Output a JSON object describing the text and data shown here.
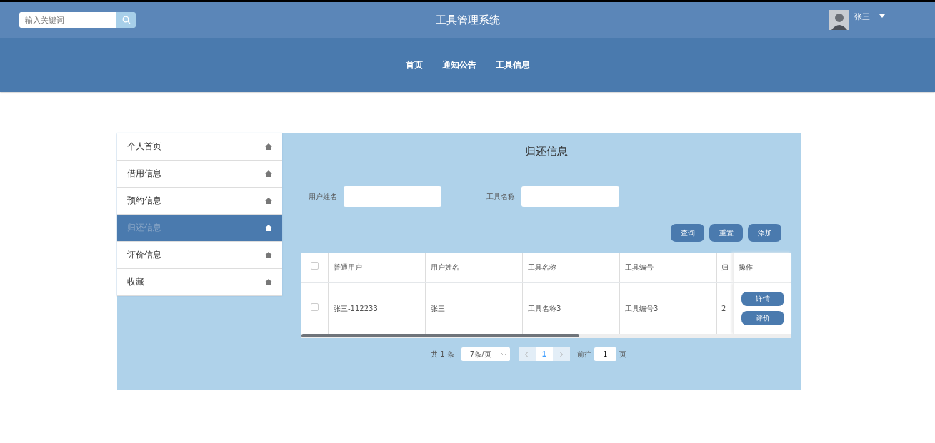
{
  "header": {
    "search": {
      "placeholder": "输入关键词"
    },
    "title": "工具管理系统",
    "user": {
      "name": "张三"
    }
  },
  "nav": [
    {
      "label": "首页"
    },
    {
      "label": "通知公告"
    },
    {
      "label": "工具信息"
    }
  ],
  "sidebar": {
    "items": [
      {
        "label": "个人首页",
        "selected": false
      },
      {
        "label": "借用信息",
        "selected": false
      },
      {
        "label": "预约信息",
        "selected": false
      },
      {
        "label": "归还信息",
        "selected": true
      },
      {
        "label": "评价信息",
        "selected": false
      },
      {
        "label": "收藏",
        "selected": false
      }
    ]
  },
  "panel": {
    "title": "归还信息",
    "filters": [
      {
        "label": "用户姓名"
      },
      {
        "label": "工具名称"
      }
    ],
    "buttons": [
      "查询",
      "重置",
      "添加"
    ],
    "table": {
      "header_checked": false,
      "columns": [
        "普通用户",
        "用户姓名",
        "工具名称",
        "工具编号",
        "归"
      ],
      "action_column": "操作",
      "rows": [
        {
          "checked": false,
          "cells": [
            "张三-112233",
            "张三",
            "工具名称3",
            "工具编号3",
            "2"
          ],
          "actions": [
            "详情",
            "评价"
          ]
        }
      ]
    },
    "pagination": {
      "total": "共 1 条",
      "page_size": "7条/页",
      "pages": [
        {
          "label": "1",
          "selected": true
        }
      ],
      "goto_label": "前往",
      "goto_value": "1",
      "goto_suffix": "页"
    }
  }
}
